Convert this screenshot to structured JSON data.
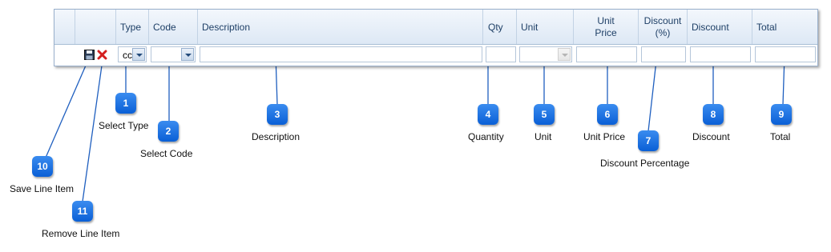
{
  "grid": {
    "columns": [
      "",
      "",
      "Type",
      "Code",
      "Description",
      "Qty",
      "Unit",
      "Unit\nPrice",
      "Discount\n(%)",
      "Discount",
      "Total"
    ],
    "row": {
      "type_value": "cc"
    }
  },
  "icons": {
    "save": "save-disk-icon",
    "remove": "red-x-icon"
  },
  "colors": {
    "callout": "#0a5fd6",
    "header": "#dde8f5",
    "border": "#99b0cc"
  },
  "callouts": [
    {
      "num": "1",
      "label": "Select Type"
    },
    {
      "num": "2",
      "label": "Select Code"
    },
    {
      "num": "3",
      "label": "Description"
    },
    {
      "num": "4",
      "label": "Quantity"
    },
    {
      "num": "5",
      "label": "Unit"
    },
    {
      "num": "6",
      "label": "Unit Price"
    },
    {
      "num": "7",
      "label": "Discount Percentage"
    },
    {
      "num": "8",
      "label": "Discount"
    },
    {
      "num": "9",
      "label": "Total"
    },
    {
      "num": "10",
      "label": "Save Line Item"
    },
    {
      "num": "11",
      "label": "Remove Line Item"
    }
  ]
}
